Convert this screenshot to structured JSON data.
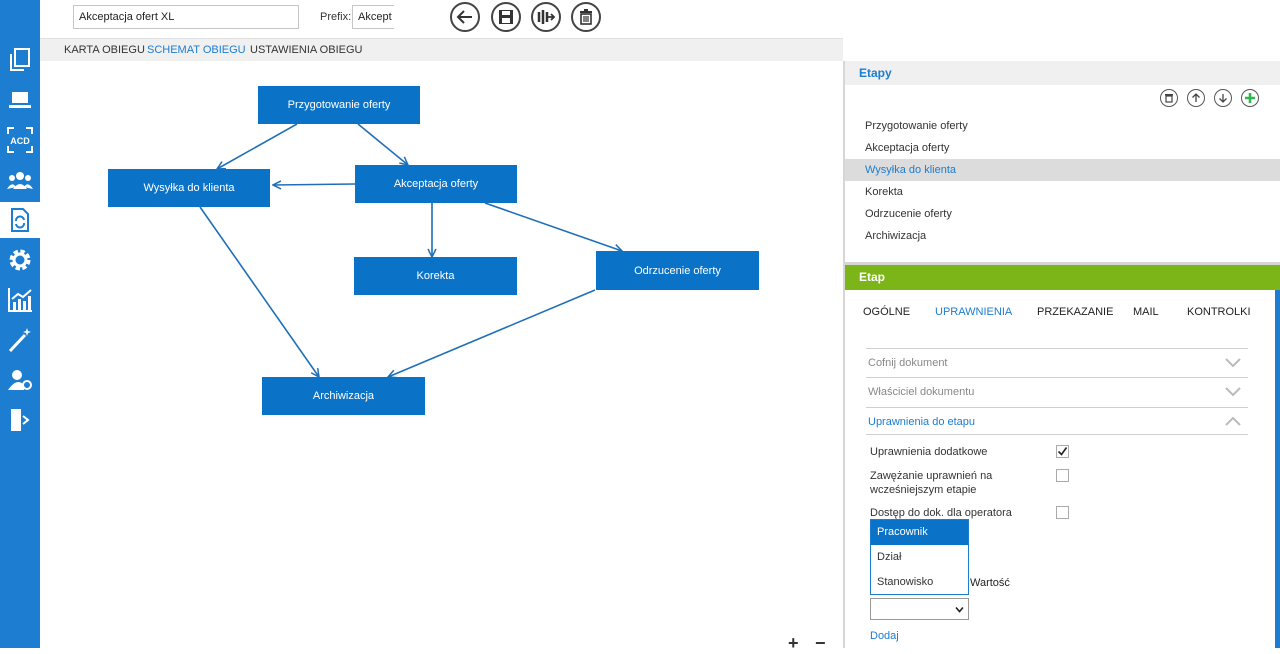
{
  "colors": {
    "accent": "#1c7dd1",
    "node": "#0a73c7",
    "green_header": "#7cb518",
    "add_green": "#2db84d"
  },
  "toolbar": {
    "name_value": "Akceptacja ofert XL",
    "prefix_label": "Prefix:",
    "prefix_value": "Akcept",
    "icons": [
      "back-icon",
      "save-icon",
      "workflow-icon",
      "delete-icon"
    ]
  },
  "rail": {
    "icons": [
      "documents-icon",
      "laptop-icon",
      "acd-icon",
      "users-icon",
      "workflow-doc-icon",
      "settings-icon",
      "chart-icon",
      "wand-icon",
      "user-settings-icon",
      "exit-icon"
    ],
    "active": 4
  },
  "tabs": [
    {
      "label": "KARTA OBIEGU",
      "selected": false
    },
    {
      "label": "SCHEMAT OBIEGU",
      "selected": true
    },
    {
      "label": "USTAWIENIA OBIEGU",
      "selected": false
    }
  ],
  "diagram": {
    "nodes": [
      {
        "id": "n1",
        "label": "Przygotowanie oferty"
      },
      {
        "id": "n2",
        "label": "Wysyłka do klienta"
      },
      {
        "id": "n3",
        "label": "Akceptacja oferty"
      },
      {
        "id": "n4",
        "label": "Korekta"
      },
      {
        "id": "n5",
        "label": "Odrzucenie oferty"
      },
      {
        "id": "n6",
        "label": "Archiwizacja"
      }
    ],
    "zoom_in": "+",
    "zoom_out": "−"
  },
  "stages_panel": {
    "title": "Etapy",
    "items": [
      "Przygotowanie oferty",
      "Akceptacja oferty",
      "Wysyłka do klienta",
      "Korekta",
      "Odrzucenie oferty",
      "Archiwizacja"
    ],
    "selected_index": 2
  },
  "stage_detail": {
    "title": "Etap",
    "tabs": [
      {
        "label": "OGÓLNE",
        "selected": false
      },
      {
        "label": "UPRAWNIENIA",
        "selected": true
      },
      {
        "label": "PRZEKAZANIE",
        "selected": false
      },
      {
        "label": "MAIL",
        "selected": false
      },
      {
        "label": "KONTROLKI",
        "selected": false
      }
    ],
    "sections": [
      {
        "label": "Cofnij dokument",
        "open": false
      },
      {
        "label": "Właściciel dokumentu",
        "open": false
      },
      {
        "label": "Uprawnienia do etapu",
        "open": true
      }
    ],
    "permissions": [
      {
        "label": "Uprawnienia dodatkowe",
        "checked": true
      },
      {
        "label": "Zawężanie uprawnień na",
        "label2": "wcześniejszym etapie",
        "checked": false
      },
      {
        "label": "Dostęp do dok. dla operatora",
        "checked": false
      }
    ],
    "dropdown_options": [
      "Pracownik",
      "Dział",
      "Stanowisko"
    ],
    "dropdown_highlighted": 0,
    "value_label": "Wartość",
    "add_link": "Dodaj"
  }
}
